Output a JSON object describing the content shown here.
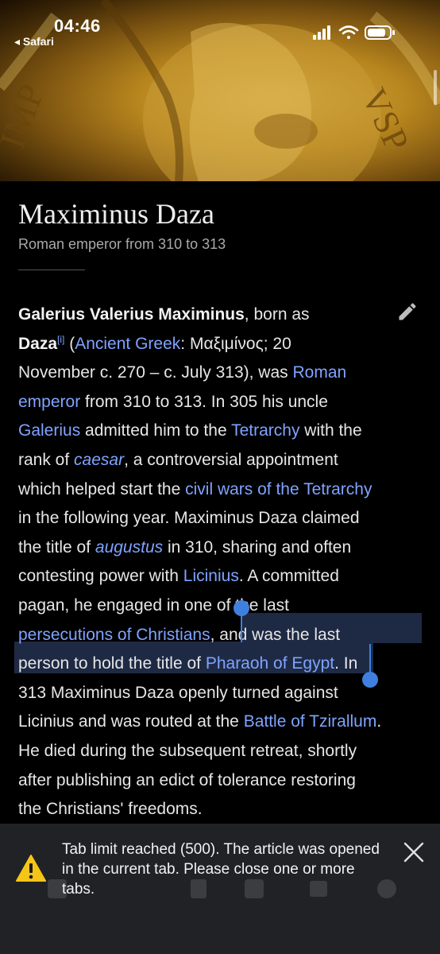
{
  "status_bar": {
    "time": "04:46",
    "back_label": "◂ Safari"
  },
  "article": {
    "title": "Maximinus Daza",
    "subtitle": "Roman emperor from 310 to 313",
    "paragraph": {
      "bold_name": "Galerius Valerius Maximinus",
      "born_as": ", born as",
      "bold_daza": "Daza",
      "note_ref": "[i]",
      "paren_open": " (",
      "link_ancient_greek": "Ancient Greek",
      "greek_text": ": Μαξιμίνος; 20",
      "line3": "November c. 270 – c. July 313), was ",
      "link_roman": "Roman",
      "link_emperor": "emperor",
      "line4_rest": " from 310 to 313. In 305 his uncle",
      "link_galerius": "Galerius",
      "line5_mid": " admitted him to the ",
      "link_tetrarchy": "Tetrarchy",
      "line5_end": " with the",
      "line6_start": "rank of ",
      "ital_caesar": "caesar",
      "line6_end": ", a controversial appointment",
      "line7_start": "which helped start the ",
      "link_civil_wars": "civil wars of the Tetrarchy",
      "line8": "in the following year. Maximinus Daza claimed",
      "line9_start": "the title of ",
      "ital_augustus": "augustus",
      "line9_end": " in 310, sharing and often",
      "line10_start": "contesting power with ",
      "link_licinius": "Licinius",
      "line10_end": ". A committed",
      "line11": "pagan, he engaged in one of the last",
      "link_persecutions": "persecutions of Christians",
      "line12_end": ", and was the last",
      "line13_start": "person to hold the title of ",
      "link_pharaoh": "Pharaoh of Egypt",
      "line13_end": ". In",
      "line14": "313 Maximinus Daza openly turned against",
      "line15_start": "Licinius and was routed at the ",
      "link_battle": "Battle of Tzirallum",
      "line15_end": ".",
      "line16": "He died during the subsequent retreat, shortly",
      "line17": "after publishing an edict of tolerance restoring",
      "line18": "the Christians' freedoms."
    }
  },
  "toast": {
    "message": "Tab limit reached (500). The article was opened in the current tab. Please close one or more tabs.",
    "warning_icon": "warning-icon",
    "close_icon": "close-icon"
  },
  "colors": {
    "link": "#7fa3ff",
    "selection": "#1e2a44",
    "handle": "#3f7fe0",
    "toast_bg": "#202226",
    "warning": "#f5c518"
  }
}
